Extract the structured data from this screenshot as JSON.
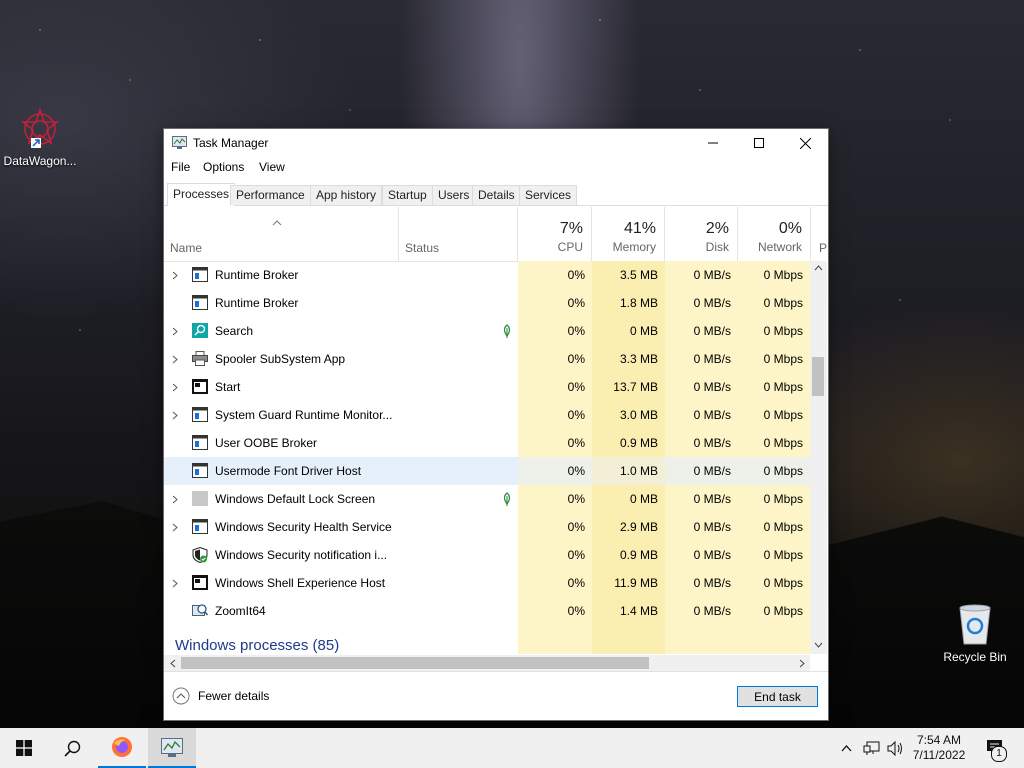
{
  "desktop": {
    "icons": [
      {
        "label": "DataWagon...",
        "icon": "datawagon-icon"
      },
      {
        "label": "Recycle Bin",
        "icon": "recycle-bin-icon"
      }
    ]
  },
  "window": {
    "title": "Task Manager",
    "menu": [
      "File",
      "Options",
      "View"
    ],
    "tabs": [
      "Processes",
      "Performance",
      "App history",
      "Startup",
      "Users",
      "Details",
      "Services"
    ],
    "active_tab": "Processes"
  },
  "columns": {
    "name": "Name",
    "status": "Status",
    "cpu": {
      "pct": "7%",
      "label": "CPU"
    },
    "memory": {
      "pct": "41%",
      "label": "Memory"
    },
    "disk": {
      "pct": "2%",
      "label": "Disk"
    },
    "network": {
      "pct": "0%",
      "label": "Network"
    },
    "partial": "P"
  },
  "processes": [
    {
      "name": "Runtime Broker",
      "expand": true,
      "cpu": "0%",
      "memory": "3.5 MB",
      "disk": "0 MB/s",
      "network": "0 Mbps",
      "icon": "window-app-icon",
      "status_leaf": false
    },
    {
      "name": "Runtime Broker",
      "expand": false,
      "cpu": "0%",
      "memory": "1.8 MB",
      "disk": "0 MB/s",
      "network": "0 Mbps",
      "icon": "window-app-icon",
      "status_leaf": false
    },
    {
      "name": "Search",
      "expand": true,
      "cpu": "0%",
      "memory": "0 MB",
      "disk": "0 MB/s",
      "network": "0 Mbps",
      "icon": "search-app-icon",
      "status_leaf": true
    },
    {
      "name": "Spooler SubSystem App",
      "expand": true,
      "cpu": "0%",
      "memory": "3.3 MB",
      "disk": "0 MB/s",
      "network": "0 Mbps",
      "icon": "printer-icon",
      "status_leaf": false
    },
    {
      "name": "Start",
      "expand": true,
      "cpu": "0%",
      "memory": "13.7 MB",
      "disk": "0 MB/s",
      "network": "0 Mbps",
      "icon": "start-app-icon",
      "status_leaf": false
    },
    {
      "name": "System Guard Runtime Monitor...",
      "expand": true,
      "cpu": "0%",
      "memory": "3.0 MB",
      "disk": "0 MB/s",
      "network": "0 Mbps",
      "icon": "window-app-icon",
      "status_leaf": false
    },
    {
      "name": "User OOBE Broker",
      "expand": false,
      "cpu": "0%",
      "memory": "0.9 MB",
      "disk": "0 MB/s",
      "network": "0 Mbps",
      "icon": "window-app-icon",
      "status_leaf": false
    },
    {
      "name": "Usermode Font Driver Host",
      "expand": false,
      "cpu": "0%",
      "memory": "1.0 MB",
      "disk": "0 MB/s",
      "network": "0 Mbps",
      "icon": "window-app-icon",
      "status_leaf": false,
      "selected": true
    },
    {
      "name": "Windows Default Lock Screen",
      "expand": true,
      "cpu": "0%",
      "memory": "0 MB",
      "disk": "0 MB/s",
      "network": "0 Mbps",
      "icon": "gray-square-icon",
      "status_leaf": true
    },
    {
      "name": "Windows Security Health Service",
      "expand": true,
      "cpu": "0%",
      "memory": "2.9 MB",
      "disk": "0 MB/s",
      "network": "0 Mbps",
      "icon": "window-app-icon",
      "status_leaf": false
    },
    {
      "name": "Windows Security notification i...",
      "expand": false,
      "cpu": "0%",
      "memory": "0.9 MB",
      "disk": "0 MB/s",
      "network": "0 Mbps",
      "icon": "shield-icon",
      "status_leaf": false
    },
    {
      "name": "Windows Shell Experience Host",
      "expand": true,
      "cpu": "0%",
      "memory": "11.9 MB",
      "disk": "0 MB/s",
      "network": "0 Mbps",
      "icon": "start-app-icon",
      "status_leaf": false
    },
    {
      "name": "ZoomIt64",
      "expand": false,
      "cpu": "0%",
      "memory": "1.4 MB",
      "disk": "0 MB/s",
      "network": "0 Mbps",
      "icon": "zoomit-icon",
      "status_leaf": false
    }
  ],
  "group_header": "Windows processes (85)",
  "footer": {
    "fewer_details": "Fewer details",
    "end_task": "End task"
  },
  "taskbar": {
    "time": "7:54 AM",
    "date": "7/11/2022",
    "notification_count": "1"
  },
  "colors": {
    "accent": "#0078d7",
    "cpu_light": "#fdf5c8",
    "memory_dark": "#fbeeb1",
    "group_text": "#1e3a8a",
    "selected_row": "#e5f0fb"
  }
}
